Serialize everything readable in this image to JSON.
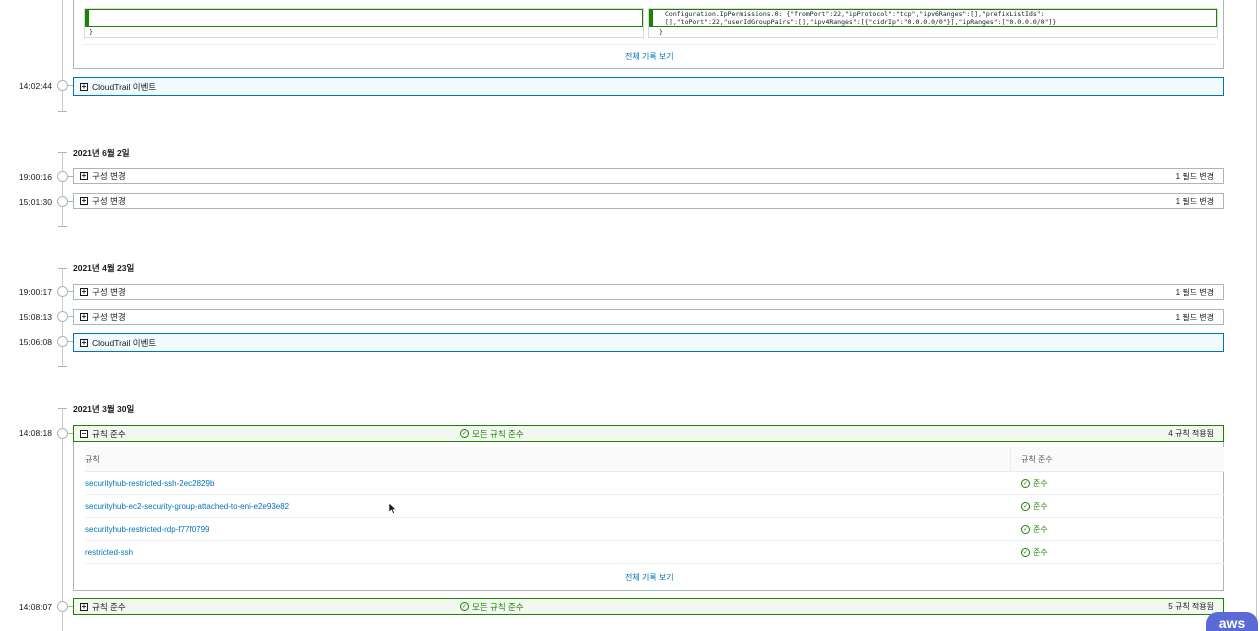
{
  "top_snippet": {
    "left_brace": "}",
    "right_line1": "Configuration.IpPermissions.0: {\"fromPort\":22,\"ipProtocol\":\"tcp\",\"ipv6Ranges\":[],\"prefixListIds\":",
    "right_line2": "[],\"toPort\":22,\"userIdGroupPairs\":[],\"ipv4Ranges\":[{\"cidrIp\":\"0.0.0.0/0\"}],\"ipRanges\":[\"0.0.0.0/0\"]}",
    "right_brace": "}",
    "show_all": "전체 기록 보기"
  },
  "events_top": [
    {
      "time": "14:02:44",
      "label": "CloudTrail 이벤트"
    }
  ],
  "groups": [
    {
      "date": "2021년 6월 2일",
      "events": [
        {
          "time": "19:00:16",
          "label": "구성 변경",
          "right": "1 필드 변경"
        },
        {
          "time": "15:01:30",
          "label": "구성 변경",
          "right": "1 필드 변경"
        }
      ]
    },
    {
      "date": "2021년 4월 23일",
      "events": [
        {
          "time": "19:00:17",
          "label": "구성 변경",
          "right": "1 필드 변경"
        },
        {
          "time": "15:08:13",
          "label": "구성 변경",
          "right": "1 필드 변경"
        },
        {
          "time": "15:06:08",
          "label": "CloudTrail 이벤트",
          "right": ""
        }
      ]
    },
    {
      "date": "2021년 3월 30일",
      "events": [
        {
          "time": "14:08:18",
          "label": "규칙 준수",
          "middle": "모든 규칙 준수",
          "right": "4 규칙 적용됨"
        },
        {
          "time": "14:08:07",
          "label": "규칙 준수",
          "middle": "모든 규칙 준수",
          "right": "5 규칙 적용됨"
        }
      ]
    }
  ],
  "rules_table": {
    "col_rule": "규칙",
    "col_compliance": "규칙 준수",
    "rows": [
      {
        "name": "securityhub-restricted-ssh-2ec2829b",
        "status": "준수"
      },
      {
        "name": "securityhub-ec2-security-group-attached-to-eni-e2e93e82",
        "status": "준수"
      },
      {
        "name": "securityhub-restricted-rdp-f77f0799",
        "status": "준수"
      },
      {
        "name": "restricted-ssh",
        "status": "준수"
      }
    ],
    "show_all": "전체 기록 보기"
  },
  "icons": {
    "expand": "plus-square-icon",
    "collapse": "minus-square-icon",
    "check": "check-circle-icon"
  },
  "colors": {
    "link": "#0073bb",
    "success": "#1d8102",
    "cloudtrail_bg": "#f1faff",
    "compliance_bg": "#f2f8f0"
  },
  "brand": "aws"
}
